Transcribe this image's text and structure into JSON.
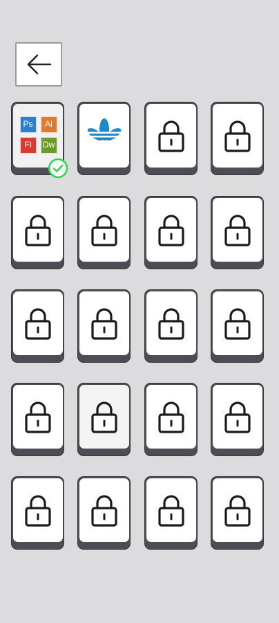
{
  "back_button": {
    "icon": "arrow-left-icon",
    "color": "#222222"
  },
  "colors": {
    "background": "#dcdbdd",
    "tile_face": "#ffffff",
    "tile_base": "#4b4f55",
    "check_green": "#27d944",
    "adidas_blue": "#1e88c8"
  },
  "levels": [
    {
      "state": "completed",
      "logo": "adobe-apps-logo",
      "apps": [
        {
          "label": "Ps",
          "color": "#2f7fd1"
        },
        {
          "label": "Ai",
          "color": "#e07b2d"
        },
        {
          "label": "Fl",
          "color": "#d93a31"
        },
        {
          "label": "Dw",
          "color": "#6d9a2b"
        }
      ]
    },
    {
      "state": "unlocked",
      "logo": "adidas-trefoil-logo"
    },
    {
      "state": "locked"
    },
    {
      "state": "locked"
    },
    {
      "state": "locked"
    },
    {
      "state": "locked"
    },
    {
      "state": "locked"
    },
    {
      "state": "locked"
    },
    {
      "state": "locked"
    },
    {
      "state": "locked"
    },
    {
      "state": "locked"
    },
    {
      "state": "locked"
    },
    {
      "state": "locked"
    },
    {
      "state": "locked",
      "highlighted": true
    },
    {
      "state": "locked"
    },
    {
      "state": "locked"
    },
    {
      "state": "locked"
    },
    {
      "state": "locked"
    },
    {
      "state": "locked"
    },
    {
      "state": "locked"
    }
  ]
}
